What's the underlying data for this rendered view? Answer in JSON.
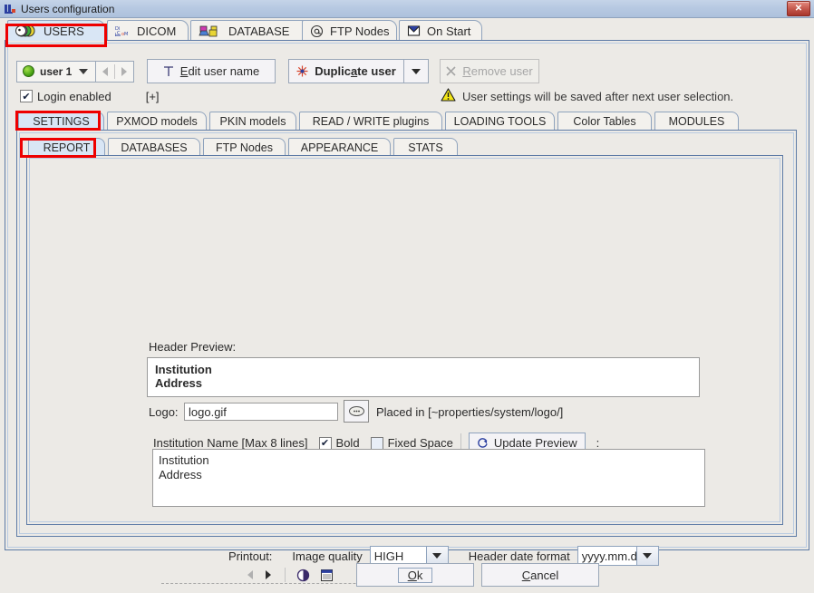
{
  "window": {
    "title": "Users configuration",
    "icon": "app-icon",
    "close_label": "✕"
  },
  "top_tabs": [
    {
      "label": "USERS",
      "icon": "users-icon",
      "active": true
    },
    {
      "label": "DICOM",
      "icon": "dicom-icon",
      "active": false
    },
    {
      "label": "DATABASE",
      "icon": "database-icon",
      "active": false
    },
    {
      "label": "FTP Nodes",
      "icon": "at-icon",
      "active": false
    },
    {
      "label": "On Start",
      "icon": "onstart-icon",
      "active": false
    }
  ],
  "user_toolbar": {
    "selected_user": "user 1",
    "prev_tooltip": "previous",
    "next_tooltip": "next",
    "edit_user_name": "Edit user name",
    "edit_user_icon": "text-T-icon",
    "duplicate_user": "Duplicate user",
    "duplicate_icon": "sparkle-icon",
    "remove_user": "Remove user",
    "remove_icon": "x-icon"
  },
  "login_row": {
    "checkbox_label": "Login enabled",
    "checkbox_checked": true,
    "expand_label": "[+]",
    "warning_icon": "warning-triangle-icon",
    "warning_text": "User settings will be saved after next user selection."
  },
  "level2_tabs": [
    {
      "label": "SETTINGS",
      "active": true
    },
    {
      "label": "PXMOD models",
      "active": false
    },
    {
      "label": "PKIN models",
      "active": false
    },
    {
      "label": "READ / WRITE plugins",
      "active": false
    },
    {
      "label": "LOADING TOOLS",
      "active": false
    },
    {
      "label": "Color Tables",
      "active": false
    },
    {
      "label": "MODULES",
      "active": false
    }
  ],
  "level3_tabs": [
    {
      "label": "REPORT",
      "active": true
    },
    {
      "label": "DATABASES",
      "active": false
    },
    {
      "label": "FTP Nodes",
      "active": false
    },
    {
      "label": "APPEARANCE",
      "active": false
    },
    {
      "label": "STATS",
      "active": false
    }
  ],
  "report": {
    "header_preview_label": "Header Preview:",
    "preview_line1": "Institution",
    "preview_line2": "Address",
    "logo_label": "Logo:",
    "logo_value": "logo.gif",
    "logo_browse_icon": "ellipsis-icon",
    "placed_in": "Placed in [~properties/system/logo/]",
    "institution_name_label": "Institution Name [Max 8 lines]",
    "bold_label": "Bold",
    "bold_checked": true,
    "fixed_space_label": "Fixed Space",
    "fixed_space_checked": false,
    "update_preview_label": "Update Preview",
    "update_preview_icon": "refresh-icon",
    "colon": ":",
    "institution_text_line1": "Institution",
    "institution_text_line2": "Address",
    "printout_label": "Printout:",
    "image_quality_label": "Image quality",
    "image_quality_value": "HIGH",
    "header_date_format_label": "Header date format",
    "header_date_format_value": "yyyy.mm.dd"
  },
  "footer": {
    "prev_icon": "left-arrow-icon",
    "next_icon": "right-arrow-icon",
    "contrast_icon": "contrast-icon",
    "calendar_icon": "calendar-icon",
    "ok_label": "Ok",
    "cancel_label": "Cancel"
  },
  "colors": {
    "accent": "#d9e6f5",
    "border": "#5d7ba6",
    "highlight": "#ee0000",
    "titlebar": "#b7c9e2"
  }
}
